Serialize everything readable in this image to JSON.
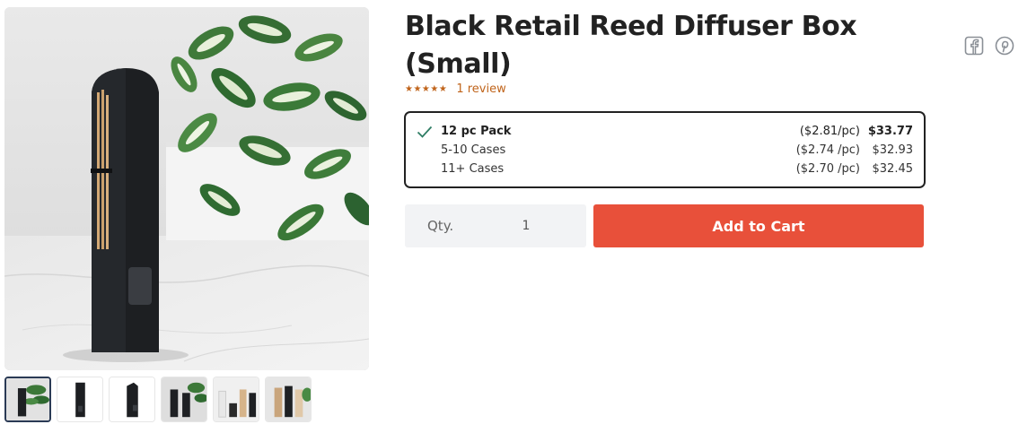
{
  "product": {
    "title": "Black Retail Reed Diffuser Box (Small)",
    "rating": {
      "stars": 5,
      "stars_text": "★★★★★",
      "review_link": "1 review",
      "color": "#c0641b"
    },
    "pricing_tiers": [
      {
        "name": "12 pc Pack",
        "per_piece": "($2.81/pc)",
        "total": "$33.77",
        "selected": true
      },
      {
        "name": "5-10 Cases",
        "per_piece": "($2.74 /pc)",
        "total": "$32.93",
        "selected": false
      },
      {
        "name": "11+ Cases",
        "per_piece": "($2.70 /pc)",
        "total": "$32.45",
        "selected": false
      }
    ],
    "quantity": {
      "label": "Qty.",
      "value": "1"
    },
    "add_to_cart_label": "Add to Cart"
  },
  "share": {
    "icons": [
      "facebook-icon",
      "pinterest-icon"
    ]
  },
  "gallery": {
    "active_index": 0,
    "thumbnails": [
      "box-with-plant",
      "box-front",
      "box-angle",
      "boxes-with-plant",
      "boxes-lineup",
      "boxes-colors"
    ]
  },
  "colors": {
    "accent": "#e8503a",
    "rating": "#c0641b",
    "check": "#2e7d64",
    "border": "#222222",
    "qty_bg": "#f2f3f5"
  }
}
